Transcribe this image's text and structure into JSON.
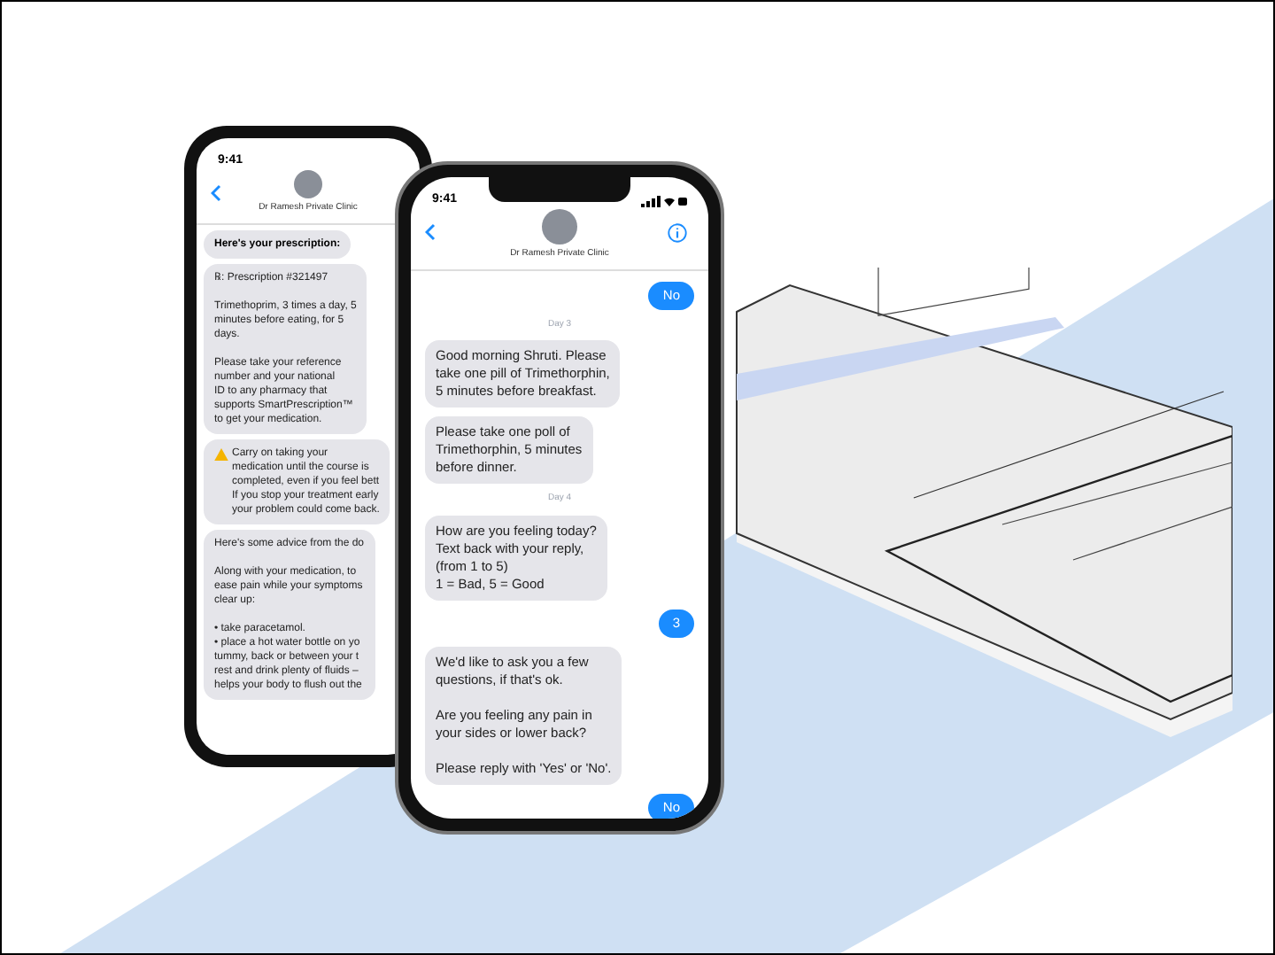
{
  "back_phone": {
    "status_time": "9:41",
    "contact_name": "Dr Ramesh Private Clinic",
    "messages": [
      {
        "kind": "bold",
        "text": "Here's your prescription:"
      },
      {
        "kind": "received",
        "text": "℞: Prescription #321497\n\nTrimethoprim, 3 times a day, 5\nminutes before eating, for 5\ndays.\n\nPlease take your reference\nnumber and your national\nID to any pharmacy that\nsupports SmartPrescription™\nto get your medication."
      },
      {
        "kind": "warning",
        "text": "Carry on taking your\nmedication until the course is\ncompleted, even if you feel bett\nIf you stop your treatment early\nyour problem could come back."
      },
      {
        "kind": "received",
        "text": "Here's some advice from the do\n\nAlong with your medication, to\nease pain while your symptoms\nclear up:\n\n• take paracetamol.\n• place a hot water bottle on yo\ntummy, back or between your t\nrest and drink plenty of fluids –\nhelps your body to flush out the"
      }
    ]
  },
  "front_phone": {
    "status_time": "9:41",
    "contact_name": "Dr Ramesh Private Clinic",
    "messages": [
      {
        "kind": "sent",
        "text": "No"
      },
      {
        "kind": "day",
        "text": "Day 3"
      },
      {
        "kind": "received",
        "text": "Good morning Shruti. Please\ntake one pill of Trimethorphin,\n5 minutes before breakfast."
      },
      {
        "kind": "received",
        "text": "Please take one poll of\nTrimethorphin, 5 minutes\nbefore dinner."
      },
      {
        "kind": "day",
        "text": "Day 4"
      },
      {
        "kind": "received",
        "text": "How are you feeling today?\nText back with your reply,\n(from 1  to 5)\n1 = Bad, 5 = Good"
      },
      {
        "kind": "sent",
        "text": "3"
      },
      {
        "kind": "received",
        "text": "We'd like to ask you a few\nquestions, if that's ok.\n\nAre you feeling any pain in\nyour sides or lower back?\n\nPlease reply with 'Yes' or 'No'."
      },
      {
        "kind": "sent",
        "text": "No"
      }
    ]
  }
}
